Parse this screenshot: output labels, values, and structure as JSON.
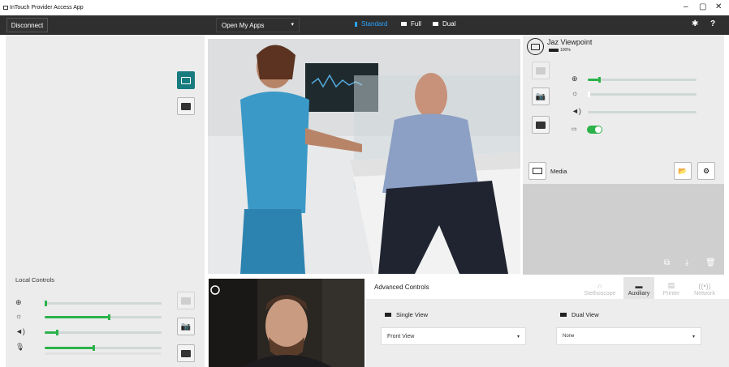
{
  "window": {
    "title": "InTouch Provider Access App"
  },
  "toolbar": {
    "disconnect": "Disconnect",
    "apps_dropdown": "Open My Apps",
    "views": [
      {
        "label": "Standard",
        "active": true
      },
      {
        "label": "Full",
        "active": false
      },
      {
        "label": "Dual",
        "active": false
      }
    ]
  },
  "local_controls": {
    "title": "Local Controls",
    "sliders": [
      {
        "name": "zoom",
        "value": 0.02
      },
      {
        "name": "brightness",
        "value": 0.55
      },
      {
        "name": "volume",
        "value": 0.1
      },
      {
        "name": "microphone",
        "value": 0.42
      }
    ]
  },
  "remote": {
    "camera_name": "Jaz Viewpoint",
    "battery": "100%",
    "sliders": [
      {
        "name": "zoom",
        "value": 0.1
      },
      {
        "name": "brightness",
        "value": 0.01
      },
      {
        "name": "volume",
        "value": 0.0
      }
    ],
    "toggle_on": true,
    "media_label": "Media"
  },
  "advanced": {
    "title": "Advanced Controls",
    "tabs": [
      {
        "label": "Stethoscope",
        "active": false
      },
      {
        "label": "Auxiliary",
        "active": true
      },
      {
        "label": "Printer",
        "active": false
      },
      {
        "label": "Network",
        "active": false
      }
    ],
    "single_view": {
      "label": "Single View",
      "value": "Front View"
    },
    "dual_view": {
      "label": "Dual View",
      "value": "None"
    }
  },
  "colors": {
    "accent": "#187b7f",
    "toggle": "#2cb24a",
    "toolbar": "#2f2f2f",
    "active_view": "#2aa3ff"
  }
}
